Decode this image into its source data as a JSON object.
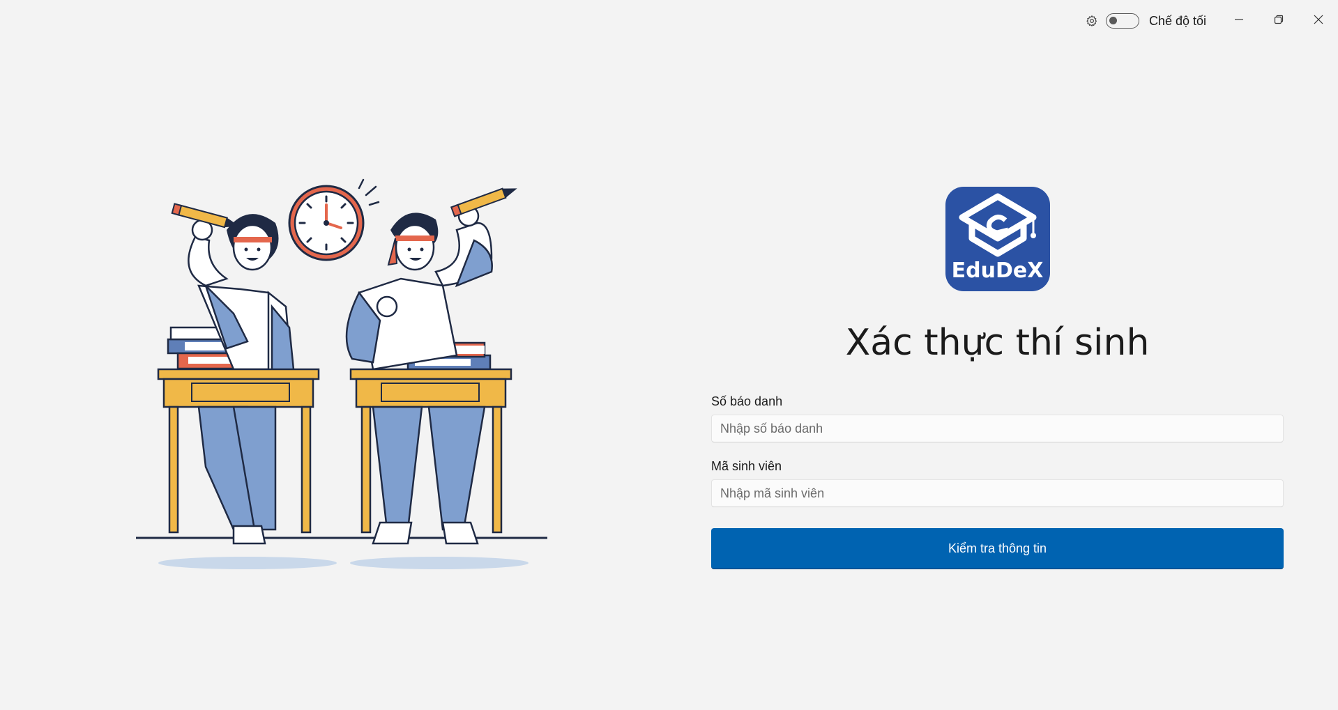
{
  "titlebar": {
    "settings_icon": "gear-icon",
    "dark_mode_label": "Chế độ tối",
    "dark_mode_on": false,
    "minimize_icon": "minimize-icon",
    "restore_icon": "restore-icon",
    "close_icon": "close-icon"
  },
  "illustration": {
    "description_icon": "students-exam-illustration"
  },
  "logo": {
    "text": "EduDeX",
    "color": "#2b52a4"
  },
  "form": {
    "title": "Xác thực thí sinh",
    "sbd_label": "Số báo danh",
    "sbd_placeholder": "Nhập số báo danh",
    "sbd_value": "",
    "msv_label": "Mã sinh viên",
    "msv_placeholder": "Nhập mã sinh viên",
    "msv_value": "",
    "submit_label": "Kiểm tra thông tin"
  },
  "colors": {
    "accent": "#0063b1",
    "background": "#f3f3f3"
  }
}
